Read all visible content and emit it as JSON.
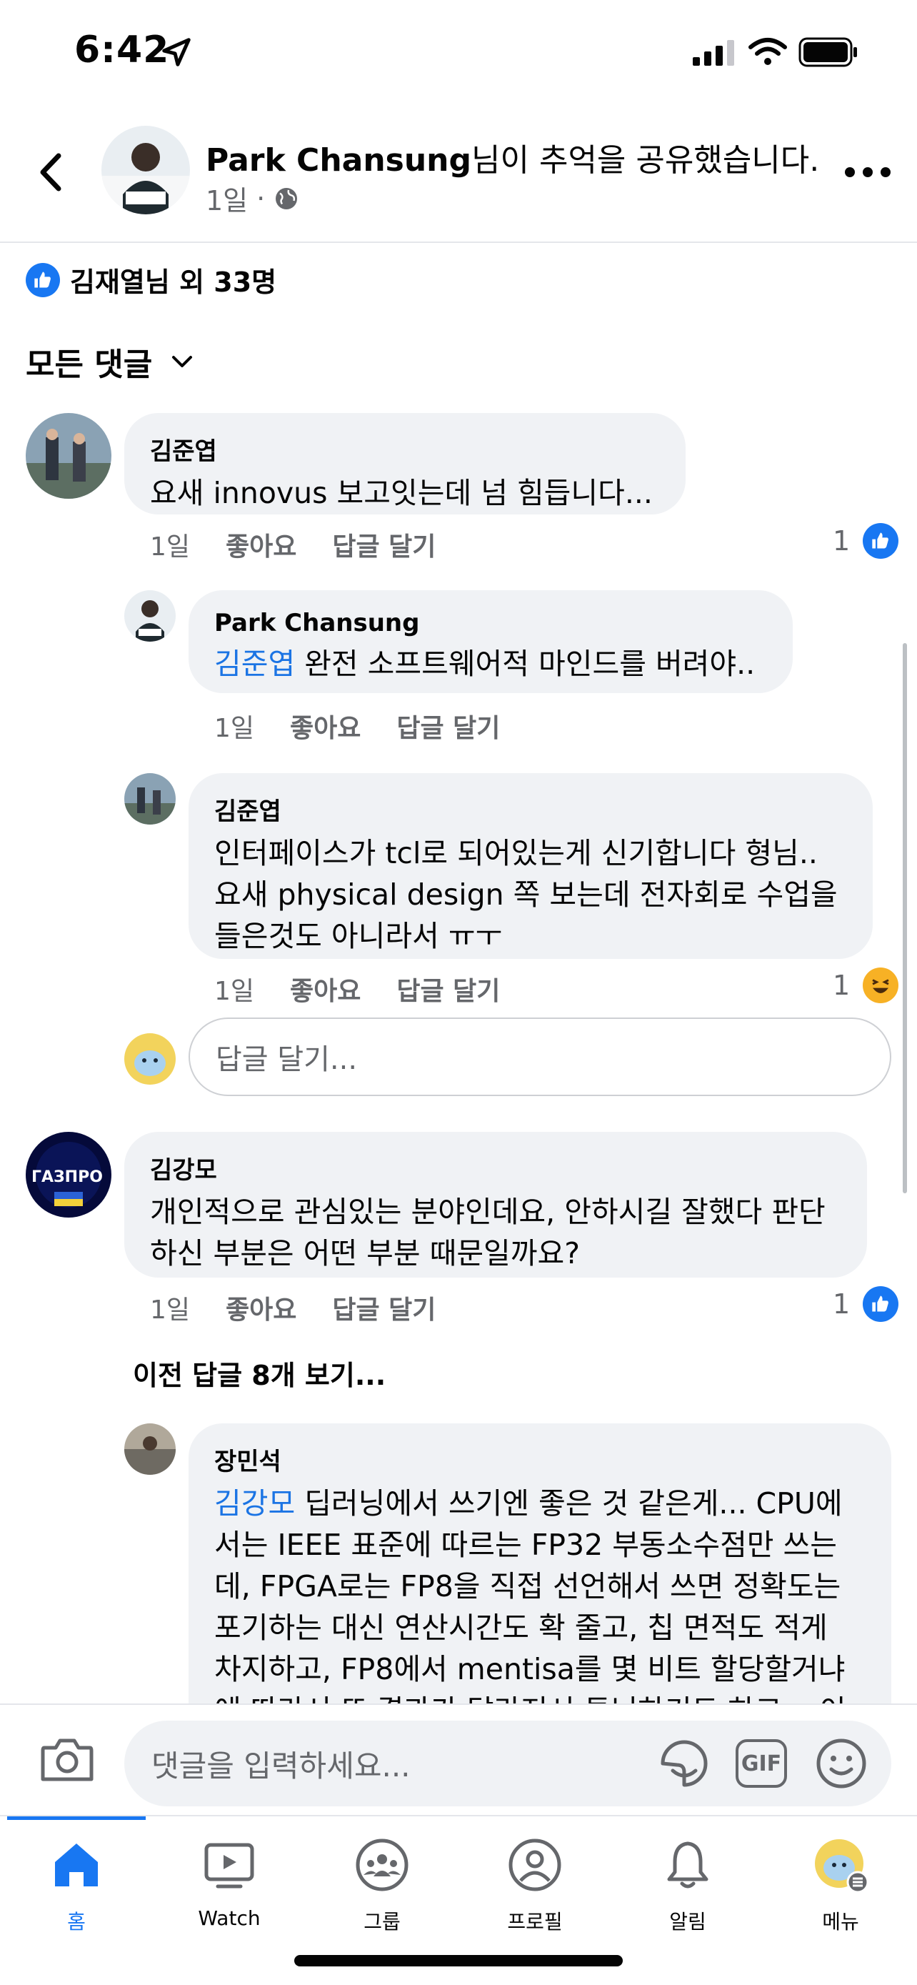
{
  "status_bar": {
    "time": "6:42"
  },
  "header": {
    "author_name": "Park Chansung",
    "title_suffix": "님이 추억을 공유했습니다.",
    "time": "1일",
    "separator": "·"
  },
  "reactions": {
    "summary": "김재열님 외 33명"
  },
  "sort": {
    "label": "모든 댓글"
  },
  "comments": [
    {
      "author": "김준엽",
      "text": "요새 innovus 보고잇는데 넘 힘듭니다...",
      "time": "1일",
      "like": "좋아요",
      "reply": "답글 달기",
      "reaction_count": "1",
      "reaction": "like-icon"
    },
    {
      "author": "Park Chansung",
      "mention": "김준엽",
      "text": " 완전 소프트웨어적 마인드를 버려야..",
      "time": "1일",
      "like": "좋아요",
      "reply": "답글 달기"
    },
    {
      "author": "김준엽",
      "text_line1": "인터페이스가 tcl로 되어있는게 신기합니다 형님..",
      "text_line2": "요새 physical design 쪽 보는데 전자회로 수업을",
      "text_line3": "들은것도 아니라서 ㅠㅜ",
      "time": "1일",
      "like": "좋아요",
      "reply": "답글 달기",
      "reaction_count": "1",
      "reaction": "haha-icon"
    },
    {
      "author": "김강모",
      "text_line1": "개인적으로 관심있는 분야인데요, 안하시길 잘했다 판단",
      "text_line2": "하신 부분은 어떤 부분 때문일까요?",
      "time": "1일",
      "like": "좋아요",
      "reply": "답글 달기",
      "reaction_count": "1",
      "reaction": "like-icon"
    },
    {
      "author": "장민석",
      "mention": "김강모",
      "text_line1": "  딥러닝에서 쓰기엔 좋은 것 같은게... CPU에",
      "text_line2": "서는 IEEE 표준에 따르는 FP32 부동소수점만 쓰는",
      "text_line3": "데, FPGA로는 FP8을 직접 선언해서 쓰면 정확도는",
      "text_line4": "포기하는 대신 연산시간도 확 줄고, 칩 면적도 적게",
      "text_line5": "차지하고, FP8에서 mentisa를 몇 비트 할당할거냐",
      "text_line6": "에 따라서 또 결과가 달라져서 튜닝하기도 하고... 이"
    }
  ],
  "reply_box": {
    "placeholder": "답글 달기..."
  },
  "more_replies": {
    "label": "이전 답글 8개 보기..."
  },
  "composer": {
    "placeholder": "댓글을 입력하세요...",
    "gif_label": "GIF"
  },
  "tabs": [
    {
      "label": "홈",
      "icon": "home-icon",
      "active": true
    },
    {
      "label": "Watch",
      "icon": "watch-icon"
    },
    {
      "label": "그룹",
      "icon": "groups-icon"
    },
    {
      "label": "프로필",
      "icon": "profile-icon"
    },
    {
      "label": "알림",
      "icon": "bell-icon"
    },
    {
      "label": "메뉴",
      "icon": "menu-avatar-icon"
    }
  ],
  "colors": {
    "accent": "#1877f2",
    "bubble": "#f0f2f5",
    "secondary_text": "#65676b",
    "mention": "#1b74e4"
  }
}
